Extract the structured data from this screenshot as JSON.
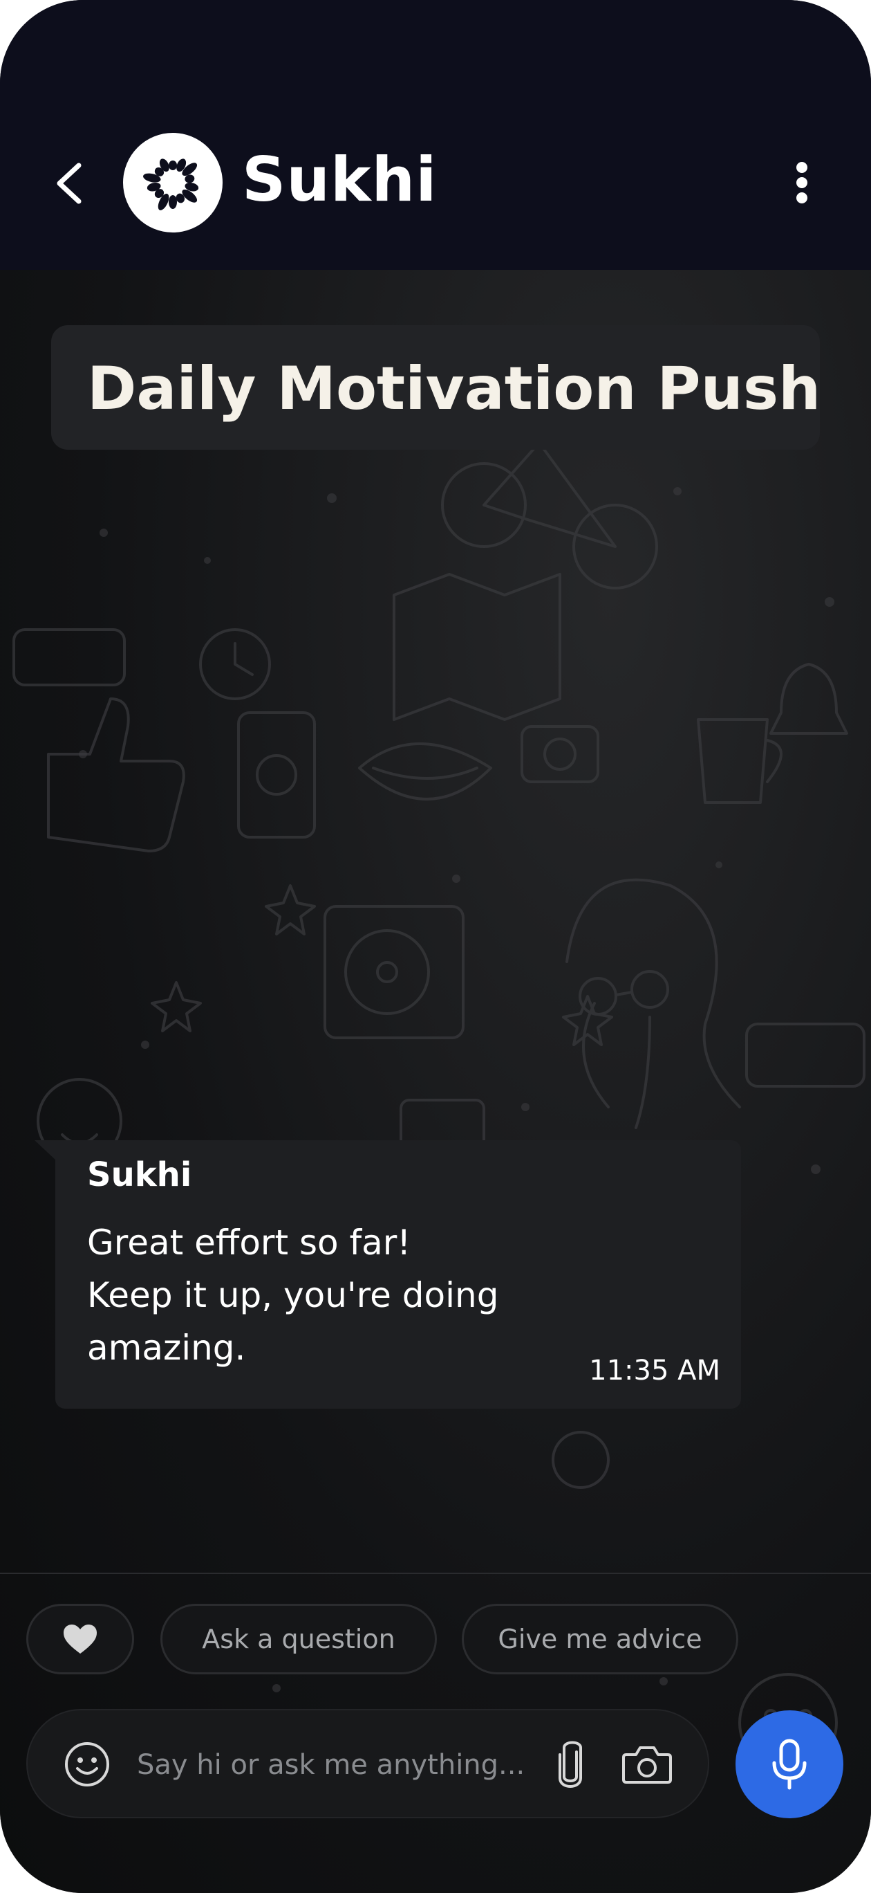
{
  "header": {
    "app_name": "Sukhi"
  },
  "main": {
    "title": "Daily Motivation Push",
    "message": {
      "sender": "Sukhi",
      "text": "Great effort so far!\nKeep it up, you're doing\namazing.",
      "time": "11:35 AM"
    }
  },
  "quick_replies": [
    "Ask a question",
    "Give me advice"
  ],
  "composer": {
    "placeholder": "Say hi or ask me anything..."
  },
  "colors": {
    "header_bg": "#0d0e1c",
    "bubble_bg": "#1e1f22",
    "accent": "#2d6ae5"
  },
  "icons": [
    "back-icon",
    "logo-icon",
    "more-icon",
    "heart-icon",
    "emoji-icon",
    "attach-icon",
    "camera-icon",
    "mic-icon"
  ]
}
